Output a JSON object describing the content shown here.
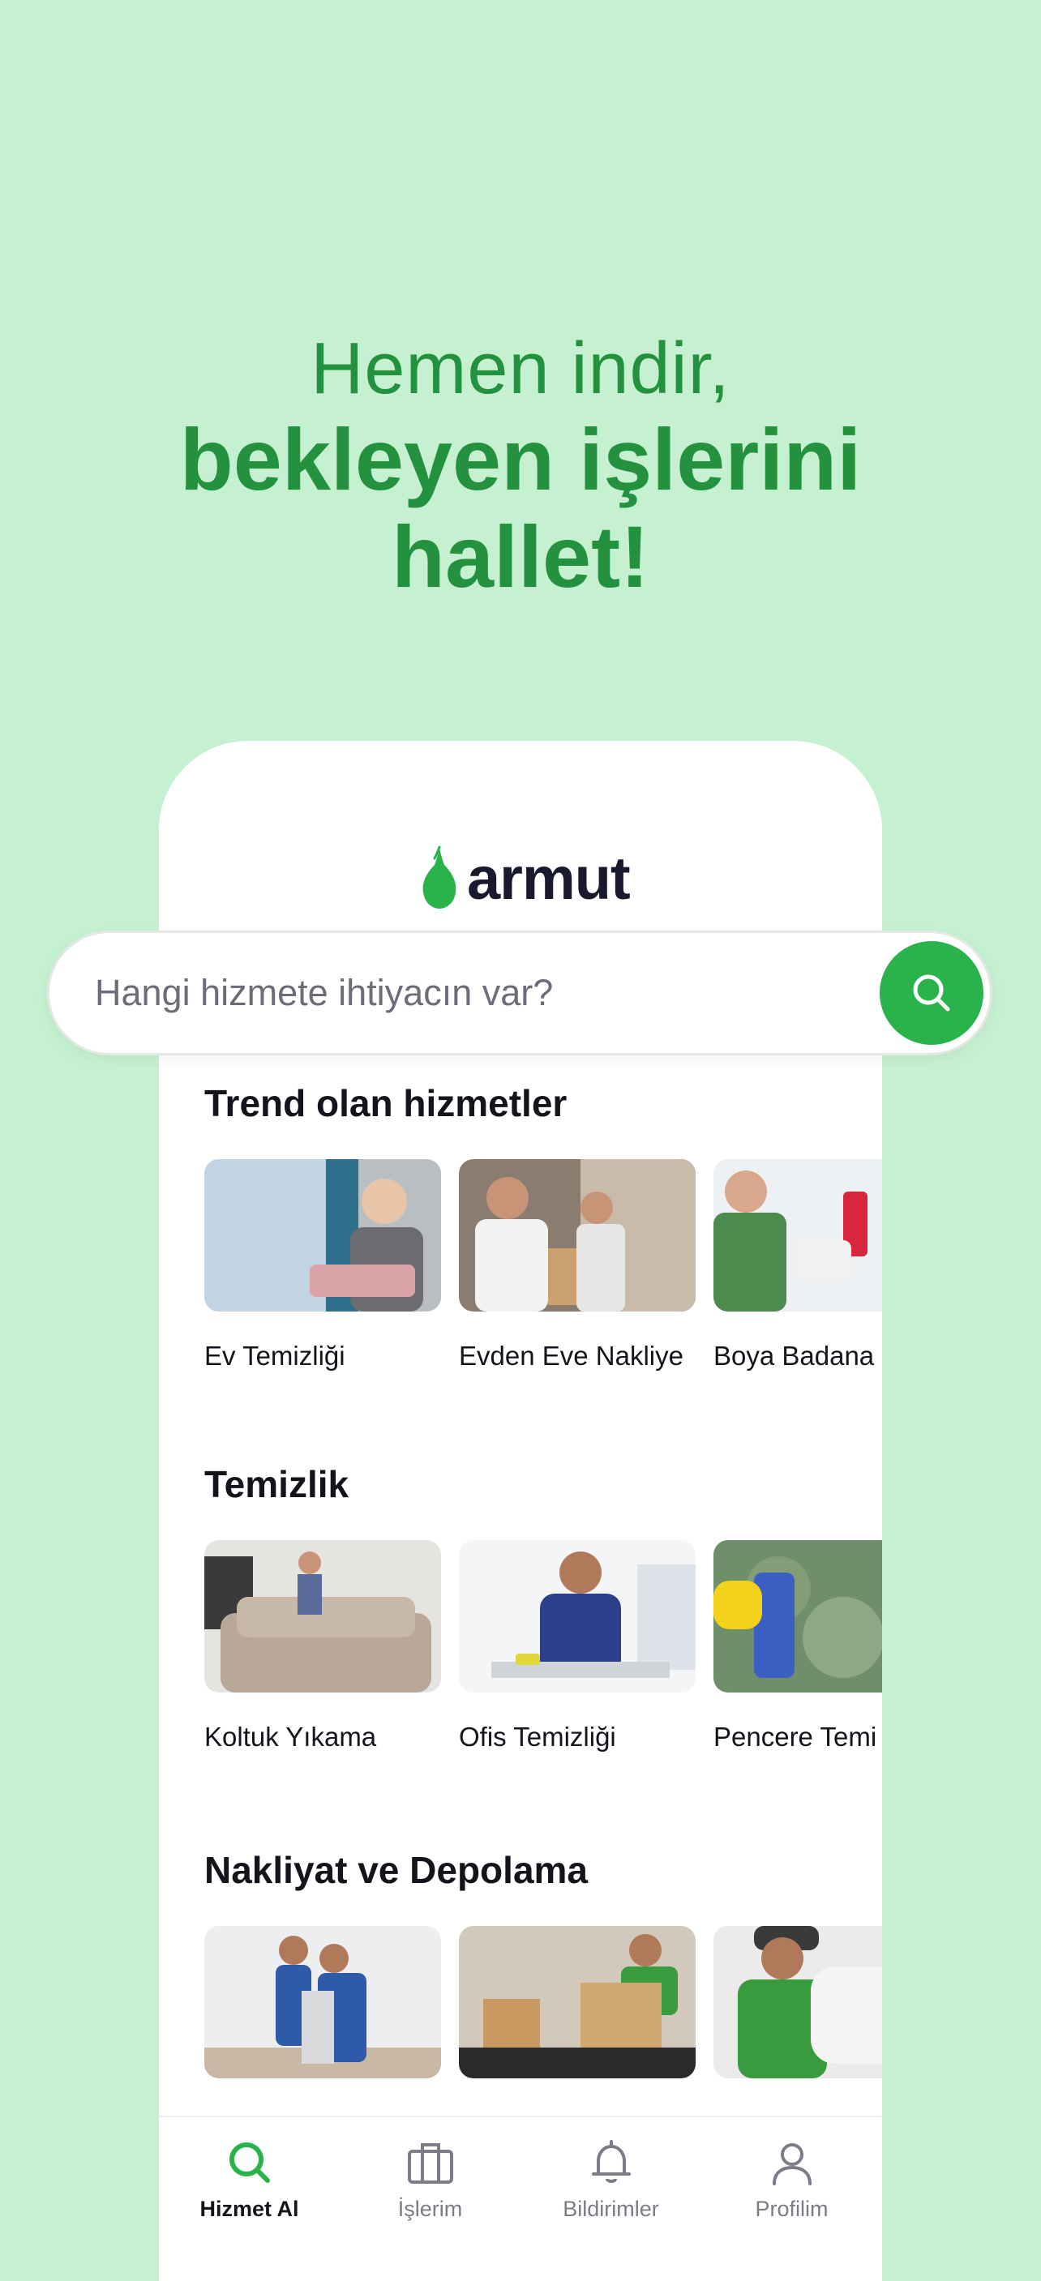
{
  "headline": {
    "line1": "Hemen indir,",
    "line2": "bekleyen işlerini",
    "line3": "hallet!"
  },
  "app": {
    "logo_text": "armut",
    "brand_color": "#2bb34b"
  },
  "search": {
    "placeholder": "Hangi hizmete ihtiyacın var?",
    "icon": "search-icon"
  },
  "sections": [
    {
      "title": "Trend olan hizmetler",
      "items": [
        {
          "label": "Ev Temizliği"
        },
        {
          "label": "Evden Eve Nakliye"
        },
        {
          "label": "Boya Badana"
        }
      ]
    },
    {
      "title": "Temizlik",
      "items": [
        {
          "label": "Koltuk Yıkama"
        },
        {
          "label": "Ofis Temizliği"
        },
        {
          "label": "Pencere Temi"
        }
      ]
    },
    {
      "title": "Nakliyat ve Depolama",
      "items": [
        {
          "label": ""
        },
        {
          "label": ""
        },
        {
          "label": ""
        }
      ]
    }
  ],
  "tabbar": {
    "tabs": [
      {
        "label": "Hizmet Al",
        "icon": "search-icon",
        "active": true
      },
      {
        "label": "İşlerim",
        "icon": "briefcase-icon",
        "active": false
      },
      {
        "label": "Bildirimler",
        "icon": "bell-icon",
        "active": false
      },
      {
        "label": "Profilim",
        "icon": "user-icon",
        "active": false
      }
    ]
  }
}
